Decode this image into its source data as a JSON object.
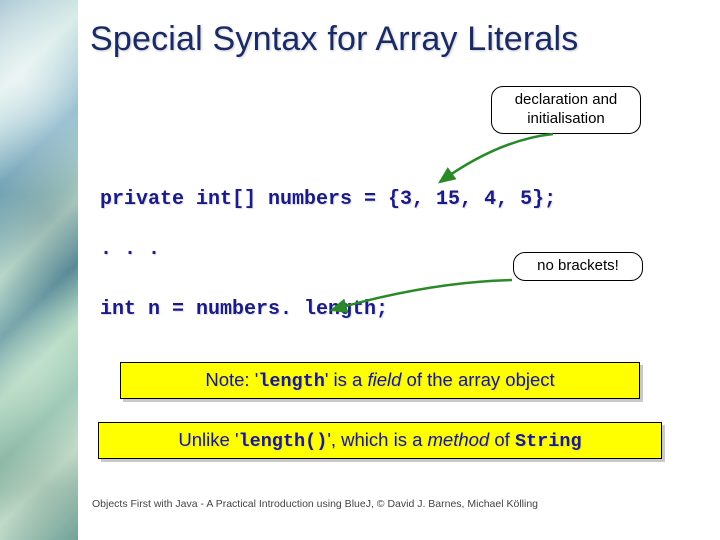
{
  "title": "Special Syntax for Array Literals",
  "callouts": {
    "decl": "declaration and initialisation",
    "nobrackets": "no brackets!"
  },
  "code": {
    "line1": "private int[] numbers = {3, 15, 4, 5};",
    "dots": ". . .",
    "line2": "int n = numbers. length;"
  },
  "notes": {
    "field_pre": "Note: '",
    "field_code": "length",
    "field_mid": "' is a ",
    "field_ital": "field",
    "field_post": " of the array object",
    "method_pre": "Unlike '",
    "method_code": "length()",
    "method_mid": "', which is a ",
    "method_ital": "method",
    "method_of": " of ",
    "method_cls": "String"
  },
  "footer": "Objects First with Java - A Practical Introduction using BlueJ, © David J. Barnes, Michael Kölling"
}
